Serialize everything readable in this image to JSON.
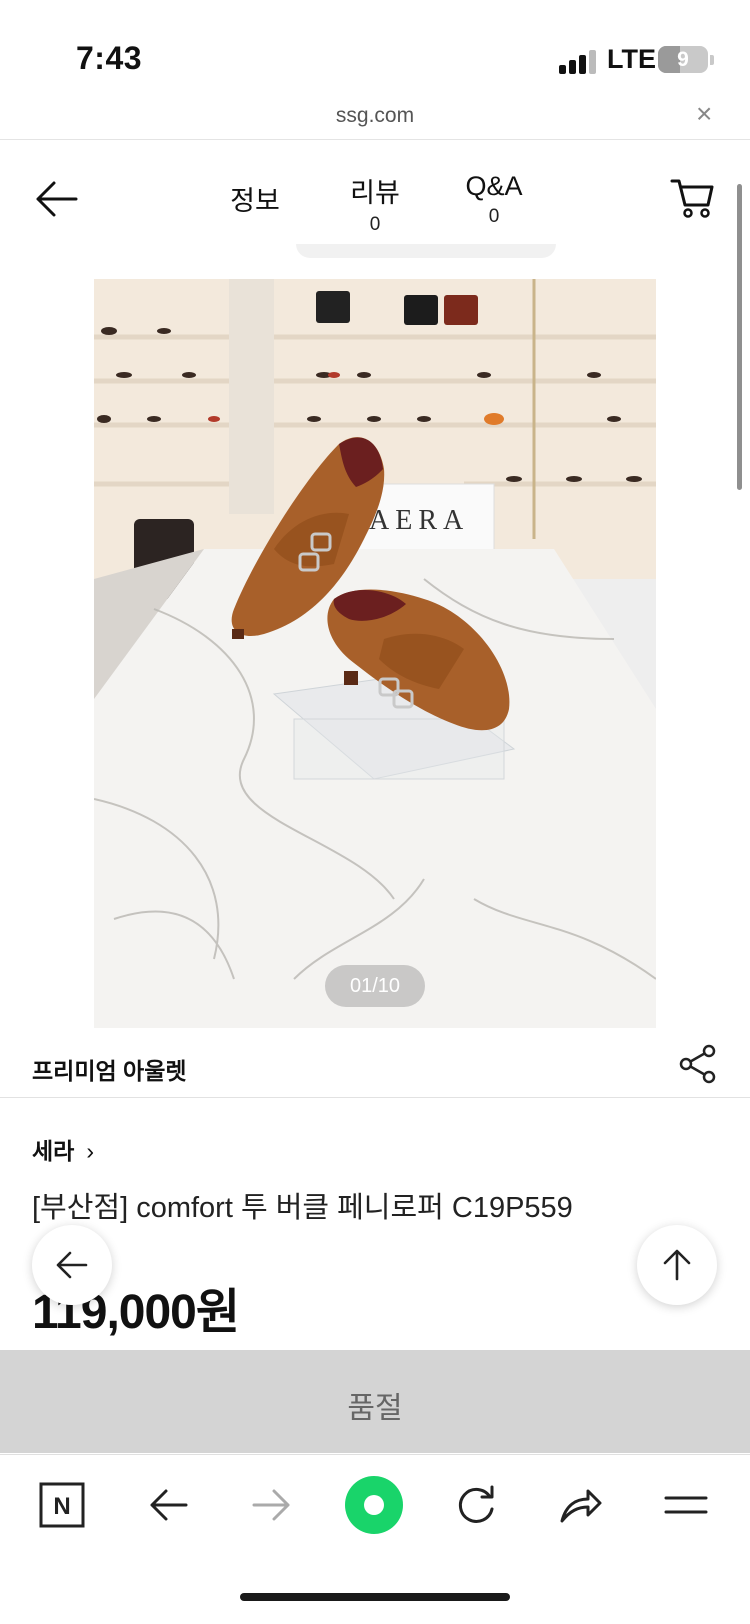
{
  "status_bar": {
    "time": "7:43",
    "network": "LTE",
    "battery_level": "9"
  },
  "url_bar": {
    "domain": "ssg.com",
    "close_glyph": "×"
  },
  "product_nav": {
    "back_icon": "arrow-left-icon",
    "tabs": [
      {
        "label": "정보"
      },
      {
        "label": "리뷰",
        "count": "0"
      },
      {
        "label": "Q&A",
        "count": "0"
      }
    ],
    "cart_icon": "cart-icon"
  },
  "image": {
    "counter": "01/10",
    "store_sign": "AERA"
  },
  "store": {
    "name": "프리미엄 아울렛",
    "share_icon": "share-icon"
  },
  "product": {
    "brand": "세라",
    "brand_chevron": "›",
    "title": "[부산점] comfort 투 버클 페니로퍼 C19P559",
    "price": "119,000원"
  },
  "soldout": {
    "label": "품절"
  },
  "browser_toolbar": {
    "items": [
      "naver-n-icon",
      "back-icon",
      "forward-icon",
      "green-dot-icon",
      "reload-icon",
      "share-arrow-icon",
      "menu-icon"
    ],
    "n_label": "N"
  },
  "colors": {
    "accent_green": "#19d46a",
    "soldout_bg": "#d4d4d4",
    "shoe_brown": "#a8602a"
  }
}
